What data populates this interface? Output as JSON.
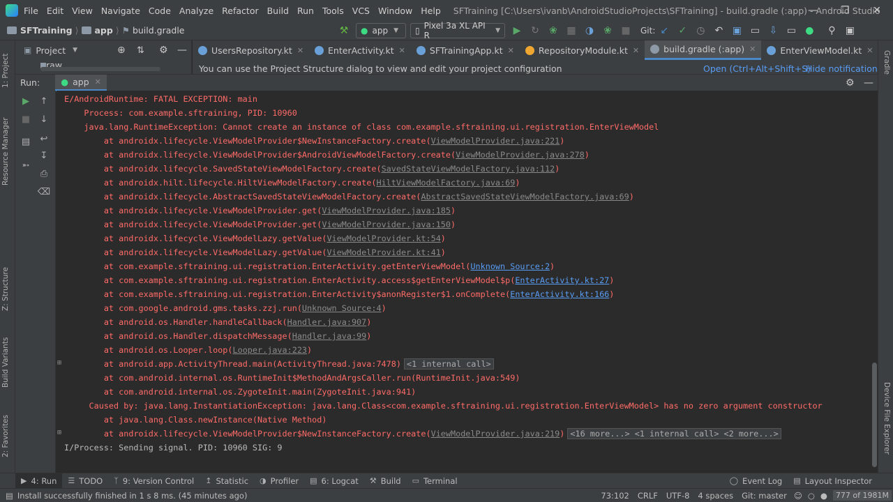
{
  "window": {
    "menus": [
      "File",
      "Edit",
      "View",
      "Navigate",
      "Code",
      "Analyze",
      "Refactor",
      "Build",
      "Run",
      "Tools",
      "VCS",
      "Window",
      "Help"
    ],
    "title": "SFTraining [C:\\Users\\ivanb\\AndroidStudioProjects\\SFTraining] - build.gradle (:app) - Android Studio"
  },
  "breadcrumb": {
    "project": "SFTraining",
    "module": "app",
    "file": "build.gradle"
  },
  "toolbar": {
    "run_config": "app",
    "device": "Pixel 3a XL API R",
    "git_label": "Git:"
  },
  "project_panel": {
    "title": "Project",
    "partial_item": "raw"
  },
  "editor_tabs": [
    {
      "label": "UsersRepository.kt",
      "color": "#a97bff"
    },
    {
      "label": "EnterActivity.kt",
      "color": "#a97bff"
    },
    {
      "label": "SFTrainingApp.kt",
      "color": "#a97bff"
    },
    {
      "label": "RepositoryModule.kt",
      "color": "#f0a732"
    },
    {
      "label": "build.gradle (:app)",
      "color": "#6e9bbd"
    },
    {
      "label": "EnterViewModel.kt",
      "color": "#a97bff"
    }
  ],
  "notification": {
    "message": "You can use the Project Structure dialog to view and edit your project configuration",
    "open_link": "Open (Ctrl+Alt+Shift+S)",
    "hide_link": "Hide notification"
  },
  "run_panel": {
    "label": "Run:",
    "tab": "app"
  },
  "console_lines": [
    {
      "indent": "",
      "text": "E/AndroidRuntime: FATAL EXCEPTION: main",
      "link": "",
      "after": "",
      "blue": false,
      "fold": ""
    },
    {
      "indent": "    ",
      "text": "Process: com.example.sftraining, PID: 10960",
      "link": "",
      "after": "",
      "blue": false,
      "fold": ""
    },
    {
      "indent": "    ",
      "text": "java.lang.RuntimeException: Cannot create an instance of class com.example.sftraining.ui.registration.EnterViewModel",
      "link": "",
      "after": "",
      "blue": false,
      "fold": ""
    },
    {
      "indent": "        ",
      "text": "at androidx.lifecycle.ViewModelProvider$NewInstanceFactory.create(",
      "link": "ViewModelProvider.java:221",
      "after": ")",
      "blue": false,
      "fold": ""
    },
    {
      "indent": "        ",
      "text": "at androidx.lifecycle.ViewModelProvider$AndroidViewModelFactory.create(",
      "link": "ViewModelProvider.java:278",
      "after": ")",
      "blue": false,
      "fold": ""
    },
    {
      "indent": "        ",
      "text": "at androidx.lifecycle.SavedStateViewModelFactory.create(",
      "link": "SavedStateViewModelFactory.java:112",
      "after": ")",
      "blue": false,
      "fold": ""
    },
    {
      "indent": "        ",
      "text": "at androidx.hilt.lifecycle.HiltViewModelFactory.create(",
      "link": "HiltViewModelFactory.java:69",
      "after": ")",
      "blue": false,
      "fold": ""
    },
    {
      "indent": "        ",
      "text": "at androidx.lifecycle.AbstractSavedStateViewModelFactory.create(",
      "link": "AbstractSavedStateViewModelFactory.java:69",
      "after": ")",
      "blue": false,
      "fold": ""
    },
    {
      "indent": "        ",
      "text": "at androidx.lifecycle.ViewModelProvider.get(",
      "link": "ViewModelProvider.java:185",
      "after": ")",
      "blue": false,
      "fold": ""
    },
    {
      "indent": "        ",
      "text": "at androidx.lifecycle.ViewModelProvider.get(",
      "link": "ViewModelProvider.java:150",
      "after": ")",
      "blue": false,
      "fold": ""
    },
    {
      "indent": "        ",
      "text": "at androidx.lifecycle.ViewModelLazy.getValue(",
      "link": "ViewModelProvider.kt:54",
      "after": ")",
      "blue": false,
      "fold": ""
    },
    {
      "indent": "        ",
      "text": "at androidx.lifecycle.ViewModelLazy.getValue(",
      "link": "ViewModelProvider.kt:41",
      "after": ")",
      "blue": false,
      "fold": ""
    },
    {
      "indent": "        ",
      "text": "at com.example.sftraining.ui.registration.EnterActivity.getEnterViewModel(",
      "link": "Unknown Source:2",
      "after": ")",
      "blue": true,
      "fold": ""
    },
    {
      "indent": "        ",
      "text": "at com.example.sftraining.ui.registration.EnterActivity.access$getEnterViewModel$p(",
      "link": "EnterActivity.kt:27",
      "after": ")",
      "blue": true,
      "fold": ""
    },
    {
      "indent": "        ",
      "text": "at com.example.sftraining.ui.registration.EnterActivity$anonRegister$1.onComplete(",
      "link": "EnterActivity.kt:166",
      "after": ")",
      "blue": true,
      "fold": ""
    },
    {
      "indent": "        ",
      "text": "at com.google.android.gms.tasks.zzj.run(",
      "link": "Unknown Source:4",
      "after": ")",
      "blue": false,
      "fold": ""
    },
    {
      "indent": "        ",
      "text": "at android.os.Handler.handleCallback(",
      "link": "Handler.java:907",
      "after": ")",
      "blue": false,
      "fold": ""
    },
    {
      "indent": "        ",
      "text": "at android.os.Handler.dispatchMessage(",
      "link": "Handler.java:99",
      "after": ")",
      "blue": false,
      "fold": ""
    },
    {
      "indent": "        ",
      "text": "at android.os.Looper.loop(",
      "link": "Looper.java:223",
      "after": ")",
      "blue": false,
      "fold": ""
    },
    {
      "indent": "        ",
      "text": "at android.app.ActivityThread.main(ActivityThread.java:7478)",
      "link": "",
      "after": "",
      "blue": false,
      "fold": "<1 internal call>"
    },
    {
      "indent": "        ",
      "text": "at com.android.internal.os.RuntimeInit$MethodAndArgsCaller.run(RuntimeInit.java:549)",
      "link": "",
      "after": "",
      "blue": false,
      "fold": ""
    },
    {
      "indent": "        ",
      "text": "at com.android.internal.os.ZygoteInit.main(ZygoteInit.java:941)",
      "link": "",
      "after": "",
      "blue": false,
      "fold": ""
    },
    {
      "indent": "     ",
      "text": "Caused by: java.lang.InstantiationException: java.lang.Class<com.example.sftraining.ui.registration.EnterViewModel> has no zero argument constructor",
      "link": "",
      "after": "",
      "blue": false,
      "fold": ""
    },
    {
      "indent": "        ",
      "text": "at java.lang.Class.newInstance(Native Method)",
      "link": "",
      "after": "",
      "blue": false,
      "fold": ""
    },
    {
      "indent": "        ",
      "text": "at androidx.lifecycle.ViewModelProvider$NewInstanceFactory.create(",
      "link": "ViewModelProvider.java:219",
      "after": ")",
      "blue": false,
      "fold": "<16 more...> <1 internal call> <2 more...>"
    },
    {
      "indent": "",
      "text": "I/Process: Sending signal. PID: 10960 SIG: 9",
      "link": "",
      "after": "",
      "blue": false,
      "fold": "",
      "info": true
    }
  ],
  "left_strip": [
    "1: Project",
    "Resource Manager",
    "Z: Structure",
    "Build Variants",
    "2: Favorites"
  ],
  "right_strip": [
    "Gradle",
    "Device File Explorer"
  ],
  "bottom_tabs": [
    {
      "label": "4: Run",
      "active": true
    },
    {
      "label": "TODO",
      "active": false
    },
    {
      "label": "9: Version Control",
      "active": false
    },
    {
      "label": "Statistic",
      "active": false
    },
    {
      "label": "Profiler",
      "active": false
    },
    {
      "label": "6: Logcat",
      "active": false
    },
    {
      "label": "Build",
      "active": false
    },
    {
      "label": "Terminal",
      "active": false
    }
  ],
  "bottom_right_tabs": [
    "Event Log",
    "Layout Inspector"
  ],
  "status": {
    "message": "Install successfully finished in 1 s 8 ms. (45 minutes ago)",
    "position": "73:102",
    "line_sep": "CRLF",
    "encoding": "UTF-8",
    "indent": "4 spaces",
    "branch": "Git: master",
    "memory": "777 of 1981M"
  }
}
